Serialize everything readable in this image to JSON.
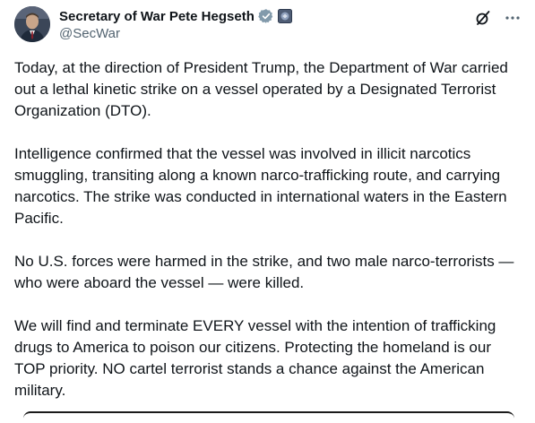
{
  "post": {
    "author": {
      "display_name": "Secretary of War Pete Hegseth",
      "handle": "@SecWar"
    },
    "icons": {
      "verified": "verified-badge-icon",
      "affiliate": "government-badge-icon",
      "grok": "grok-icon",
      "more": "more-options-icon"
    },
    "paragraphs": [
      "Today, at the direction of President Trump, the Department of War carried out a lethal kinetic strike on a vessel operated by a Designated Terrorist Organization (DTO).",
      "Intelligence confirmed that the vessel was involved in illicit narcotics smuggling, transiting along a known narco-trafficking route, and carrying narcotics. The strike was conducted in international waters in the Eastern Pacific.",
      "No U.S. forces were harmed in the strike, and two male narco-terrorists — who were aboard the vessel — were killed.",
      "We will find and terminate EVERY vessel with the intention of trafficking drugs to America to poison our citizens. Protecting the homeland is our TOP priority. NO cartel terrorist stands a chance against the American military."
    ],
    "colors": {
      "text": "#0f1419",
      "secondary": "#536471",
      "verified": "#829aab"
    }
  }
}
